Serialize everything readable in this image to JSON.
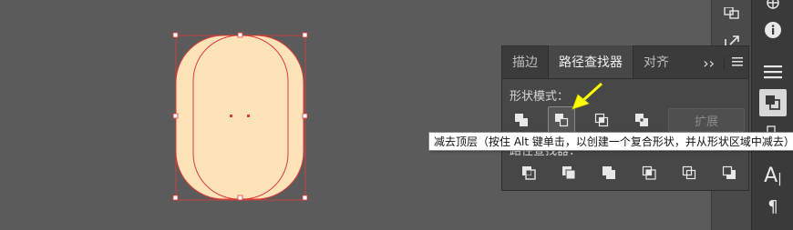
{
  "colors": {
    "canvas_bg": "#5b5b5b",
    "shape_fill": "#fde4b8",
    "path_stroke": "#e03a3a",
    "panel_bg": "#474747",
    "arrow": "#ffff00"
  },
  "panel": {
    "tabs": [
      {
        "label": "描边"
      },
      {
        "label": "路径查找器"
      },
      {
        "label": "对齐"
      }
    ],
    "overflow_label": "››",
    "menu_icon": "hamburger-menu-icon",
    "shape_modes_label": "形状模式：",
    "shape_modes": [
      {
        "icon": "unite-icon"
      },
      {
        "icon": "minus-front-icon"
      },
      {
        "icon": "intersect-icon"
      },
      {
        "icon": "exclude-icon"
      }
    ],
    "expand_label": "扩展",
    "pathfinders_label": "路径查找器：",
    "pathfinders": [
      {
        "icon": "divide-icon"
      },
      {
        "icon": "trim-icon"
      },
      {
        "icon": "merge-icon"
      },
      {
        "icon": "crop-icon"
      },
      {
        "icon": "outline-icon"
      },
      {
        "icon": "minus-back-icon"
      }
    ]
  },
  "tooltip": {
    "text": "减去顶层（按住 Alt 键单击，以创建一个复合形状，并从形状区域中减去）"
  },
  "right_toolbar": {
    "items": [
      {
        "icon": "libraries-icon"
      },
      {
        "icon": "info-icon"
      },
      {
        "icon": "align-icon"
      },
      {
        "icon": "pathfinder-icon"
      },
      {
        "icon": "character-icon",
        "glyph": "A"
      },
      {
        "icon": "paragraph-icon",
        "glyph": "¶"
      }
    ]
  },
  "dock": {
    "items": [
      {
        "icon": "artboards-icon"
      },
      {
        "icon": "export-icon"
      }
    ]
  }
}
